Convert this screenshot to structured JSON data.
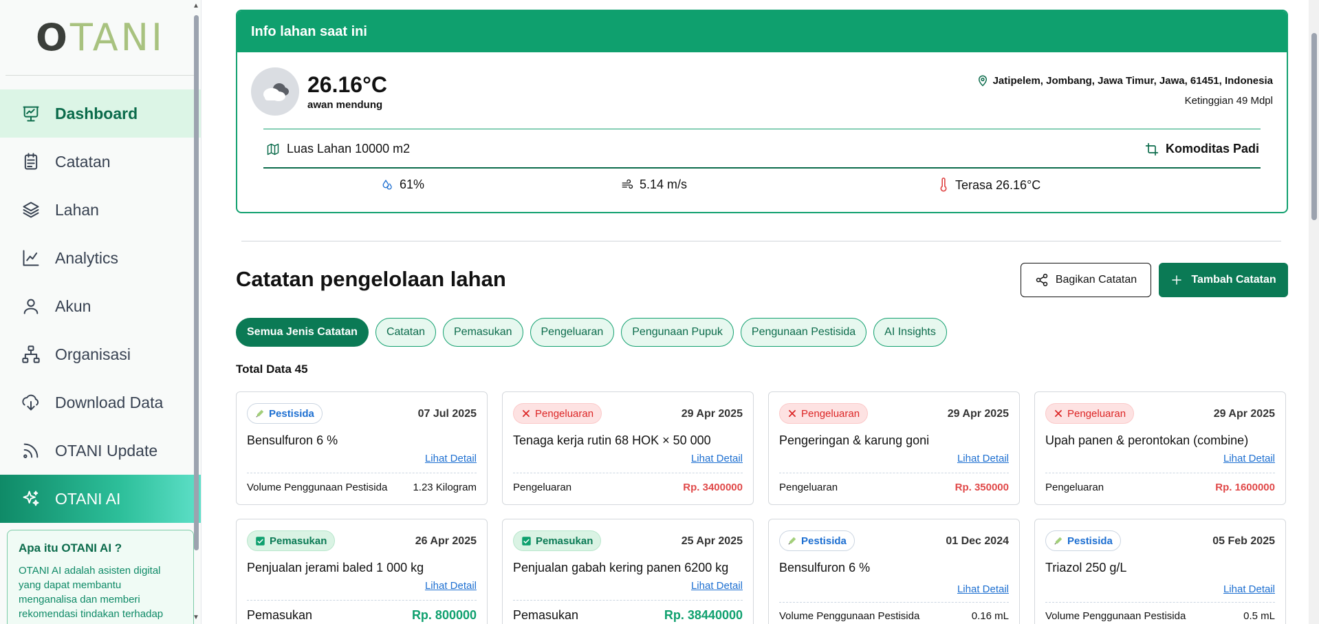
{
  "sidebar": {
    "logo_first": "O",
    "logo_rest": "TANI",
    "items": [
      {
        "label": "Dashboard",
        "icon": "presentation-chart-icon"
      },
      {
        "label": "Catatan",
        "icon": "clipboard-icon"
      },
      {
        "label": "Lahan",
        "icon": "layers-icon"
      },
      {
        "label": "Analytics",
        "icon": "line-chart-icon"
      },
      {
        "label": "Akun",
        "icon": "user-icon"
      },
      {
        "label": "Organisasi",
        "icon": "org-chart-icon"
      },
      {
        "label": "Download Data",
        "icon": "cloud-download-icon"
      },
      {
        "label": "OTANI Update",
        "icon": "rss-icon"
      },
      {
        "label": "OTANI AI",
        "icon": "sparkles-icon"
      }
    ],
    "ai_card": {
      "title": "Apa itu OTANI AI ?",
      "text": "OTANI AI adalah asisten digital yang dapat membantu menganalisa dan memberi rekomendasi tindakan terhadap lahan anda"
    }
  },
  "info": {
    "header": "Info lahan saat ini",
    "temperature": "26.16°C",
    "condition": "awan mendung",
    "location": "Jatipelem, Jombang, Jawa Timur, Jawa, 61451, Indonesia",
    "elevation": "Ketinggian 49 Mdpl",
    "area": "Luas Lahan 10000 m2",
    "commodity": "Komoditas Padi",
    "humidity": "61%",
    "wind": "5.14 m/s",
    "feels_like": "Terasa 26.16°C"
  },
  "records": {
    "title": "Catatan pengelolaan lahan",
    "share_label": "Bagikan Catatan",
    "add_label": "Tambah Catatan",
    "filters": [
      "Semua Jenis Catatan",
      "Catatan",
      "Pemasukan",
      "Pengeluaran",
      "Pengunaan Pupuk",
      "Pengunaan Pestisida",
      "AI Insights"
    ],
    "total": "Total Data 45",
    "detail_label": "Lihat Detail",
    "cards": [
      {
        "type": "pest",
        "badge": "Pestisida",
        "date": "07 Jul 2025",
        "title": "Bensulfuron 6 %",
        "foot_label": "Volume Penggunaan Pestisida",
        "foot_value": "1.23 Kilogram"
      },
      {
        "type": "peng",
        "badge": "Pengeluaran",
        "date": "29 Apr 2025",
        "title": "Tenaga kerja rutin 68 HOK × 50 000",
        "foot_label": "Pengeluaran",
        "foot_value": "Rp. 3400000"
      },
      {
        "type": "peng",
        "badge": "Pengeluaran",
        "date": "29 Apr 2025",
        "title": "Pengeringan & karung goni",
        "foot_label": "Pengeluaran",
        "foot_value": "Rp. 350000"
      },
      {
        "type": "peng",
        "badge": "Pengeluaran",
        "date": "29 Apr 2025",
        "title": "Upah panen & perontokan (combine)",
        "foot_label": "Pengeluaran",
        "foot_value": "Rp. 1600000"
      },
      {
        "type": "pem",
        "badge": "Pemasukan",
        "date": "26 Apr 2025",
        "title": "Penjualan jerami baled 1 000 kg",
        "foot_label": "Pemasukan",
        "foot_value": "Rp. 800000"
      },
      {
        "type": "pem",
        "badge": "Pemasukan",
        "date": "25 Apr 2025",
        "title": "Penjualan gabah kering panen 6200 kg",
        "foot_label": "Pemasukan",
        "foot_value": "Rp. 38440000"
      },
      {
        "type": "pest",
        "badge": "Pestisida",
        "date": "01 Dec 2024",
        "title": "Bensulfuron 6 %",
        "foot_label": "Volume Penggunaan Pestisida",
        "foot_value": "0.16 mL"
      },
      {
        "type": "pest",
        "badge": "Pestisida",
        "date": "05 Feb 2025",
        "title": "Triazol 250 g/L",
        "foot_label": "Volume Penggunaan Pestisida",
        "foot_value": "0.5 mL"
      }
    ]
  }
}
